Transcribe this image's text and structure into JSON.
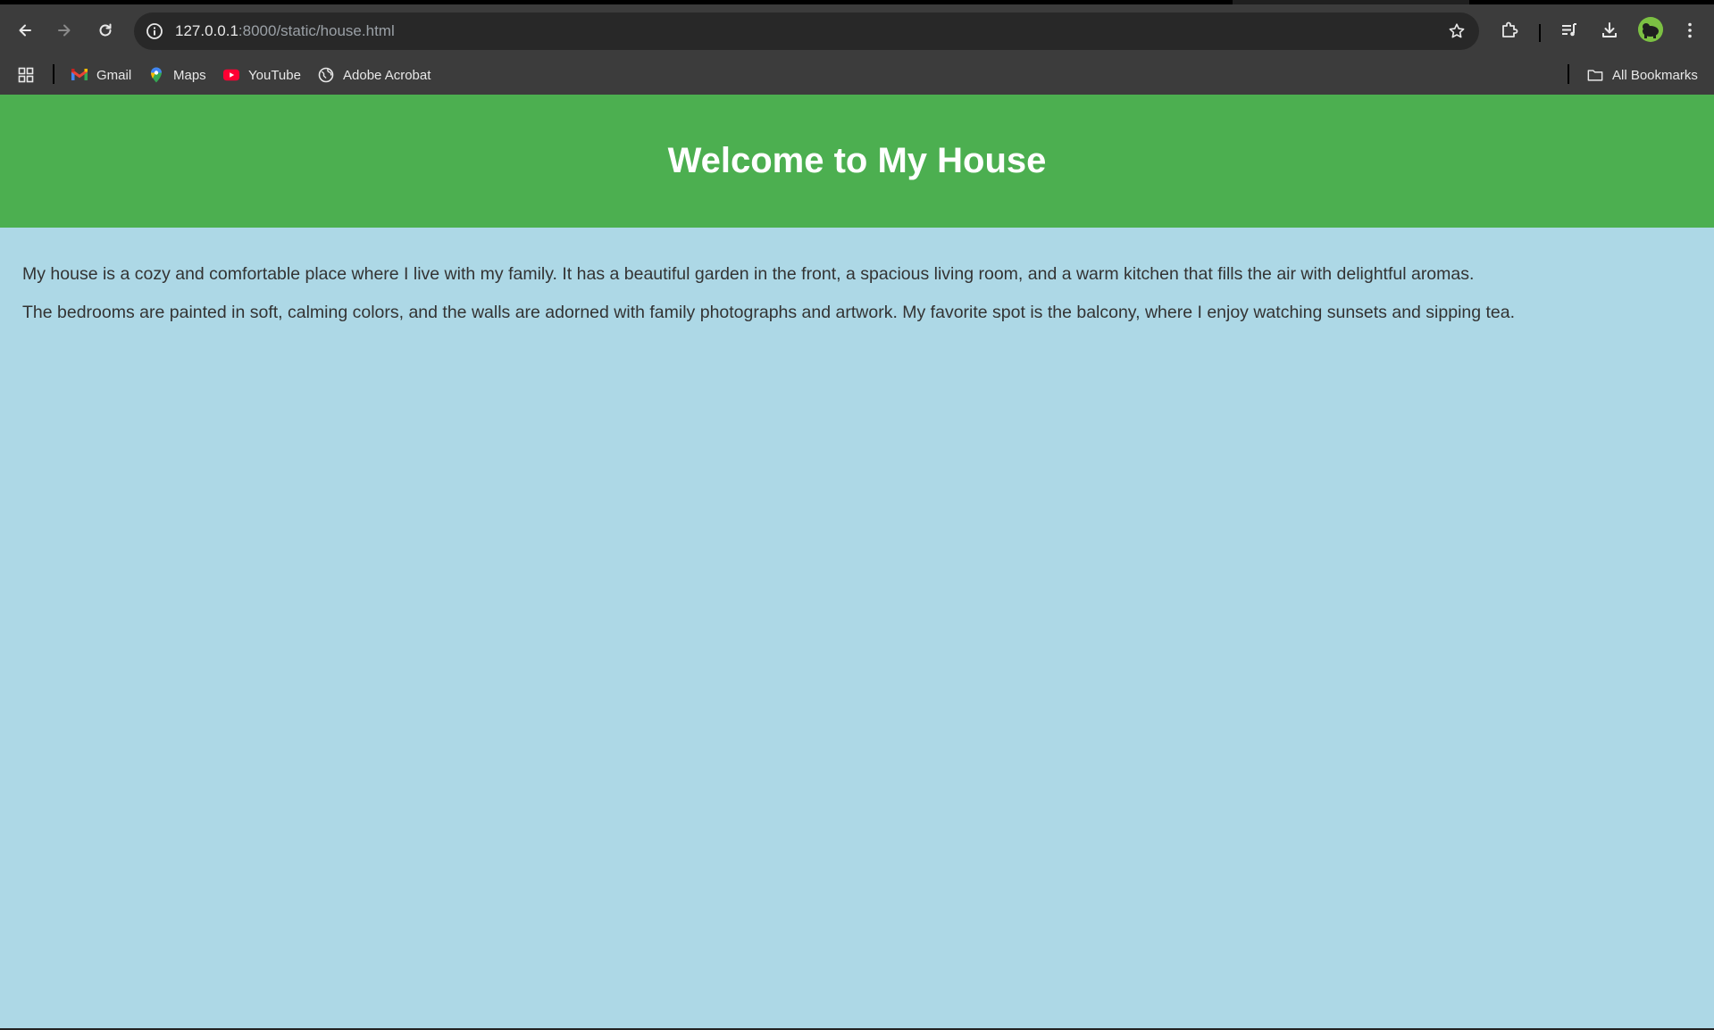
{
  "browser": {
    "url_host": "127.0.0.1",
    "url_rest": ":8000/static/house.html",
    "bookmarks": [
      {
        "label": "Gmail",
        "icon": "gmail-icon"
      },
      {
        "label": "Maps",
        "icon": "maps-icon"
      },
      {
        "label": "YouTube",
        "icon": "youtube-icon"
      },
      {
        "label": "Adobe Acrobat",
        "icon": "globe-icon"
      }
    ],
    "all_bookmarks_label": "All Bookmarks"
  },
  "page": {
    "title": "Welcome to My House",
    "paragraphs": [
      "My house is a cozy and comfortable place where I live with my family. It has a beautiful garden in the front, a spacious living room, and a warm kitchen that fills the air with delightful aromas.",
      "The bedrooms are painted in soft, calming colors, and the walls are adorned with family photographs and artwork. My favorite spot is the balcony, where I enjoy watching sunsets and sipping tea."
    ]
  },
  "colors": {
    "header_bg": "#4caf50",
    "page_bg": "#add8e6",
    "text": "#333333",
    "chrome_bg": "#3c3c3c"
  }
}
